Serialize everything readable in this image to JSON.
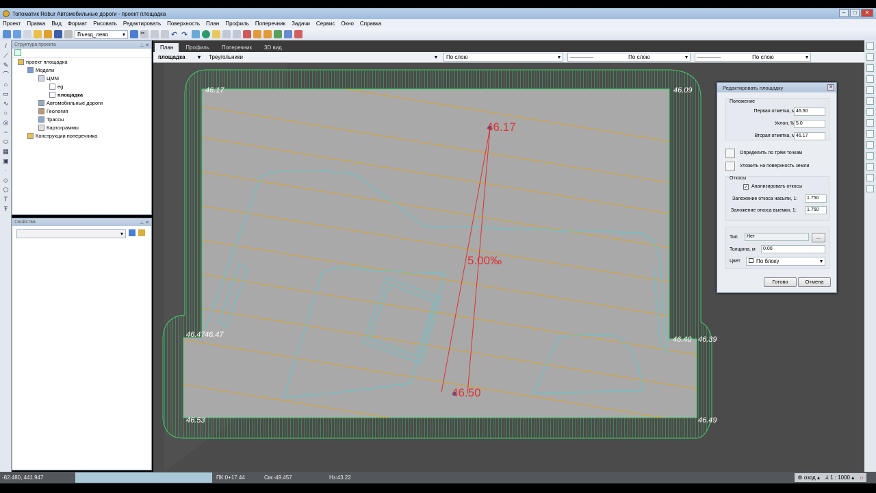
{
  "window": {
    "title": "Топоматик Robur Автомобильные дороги - проект площадка"
  },
  "menu": [
    "Проект",
    "Правка",
    "Вид",
    "Формат",
    "Рисовать",
    "Редактировать",
    "Поверхность",
    "План",
    "Профиль",
    "Поперечник",
    "Задачи",
    "Сервис",
    "Окно",
    "Справка"
  ],
  "toolbar": {
    "route_combo": "Въезд_лево"
  },
  "project_panel": {
    "title": "Структура проекта",
    "items": [
      {
        "label": "проект площадка",
        "level": 0
      },
      {
        "label": "Модели",
        "level": 1
      },
      {
        "label": "ЦММ",
        "level": 2
      },
      {
        "label": "eg",
        "level": 3
      },
      {
        "label": "площадка",
        "level": 3,
        "bold": true
      },
      {
        "label": "Автомобильные дороги",
        "level": 2
      },
      {
        "label": "Геология",
        "level": 2
      },
      {
        "label": "Трассы",
        "level": 2
      },
      {
        "label": "Картограммы",
        "level": 2
      },
      {
        "label": "Конструкции поперечника",
        "level": 1
      }
    ]
  },
  "properties_panel": {
    "title": "Свойства"
  },
  "tabs": [
    "План",
    "Профиль",
    "Поперечник",
    "3D вид"
  ],
  "active_tab": "План",
  "layerbar": {
    "layer": "площадка",
    "style": "Треугольники",
    "color": "По слою",
    "linetype": "По слою",
    "lineweight": "По слою"
  },
  "drawing": {
    "corner_labels": [
      "46.17",
      "46.09",
      "46.47",
      "46.47",
      "46.40",
      "46.39",
      "46.53",
      "46.49"
    ],
    "upper_mark": "46.17",
    "lower_mark": "46.50",
    "slope_label": "5.00‰",
    "colors": {
      "platform": "#a9a9a9",
      "outline": "#3fcf6a",
      "contour": "#e0a020",
      "slope_line": "#e03030",
      "cyan": "#5cc8d0"
    }
  },
  "dialog": {
    "title": "Редактировать площадку",
    "position_group": "Положение",
    "first_mark_label": "Первая отметка, м",
    "first_mark": "46.50",
    "slope_label": "Уклон, ‰",
    "slope": "5.0",
    "second_mark_label": "Вторая отметка, м",
    "second_mark": "46.17",
    "three_points": "Определить по трём точкам",
    "lay_on_ground": "Уложить на поверхность земли",
    "slopes_group": "Откосы",
    "analyze_slopes": "Анализировать откосы",
    "analyze_checked": true,
    "fill_slope_label": "Заложение откоса насыпи, 1:",
    "fill_slope": "1.750",
    "cut_slope_label": "Заложение откоса выемки, 1:",
    "cut_slope": "1.750",
    "type_label": "Тип",
    "type": "Нет",
    "browse": "...",
    "thickness_label": "Толщина, м",
    "thickness": "0.00",
    "color_label": "Цвет",
    "color": "По блоку",
    "ok": "Готово",
    "cancel": "Отмена"
  },
  "statusbar": {
    "coords": "-82.480, 441.947",
    "pk": "ПК:0+17.44",
    "offset": "См:-49.457",
    "elevation": "Нз:43.22",
    "snap": "озод",
    "scale": "1 : 1000"
  }
}
